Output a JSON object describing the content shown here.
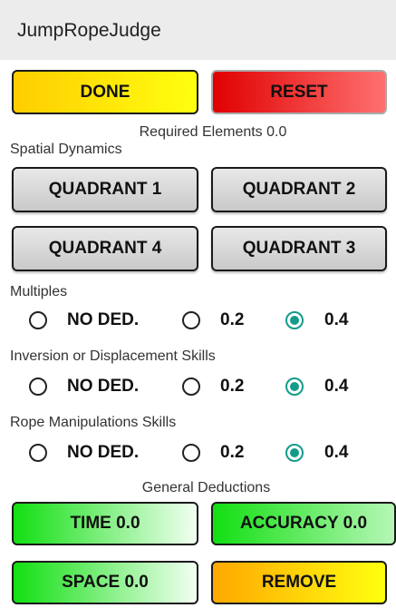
{
  "app": {
    "title": "JumpRopeJudge"
  },
  "top_buttons": {
    "done": "DONE",
    "reset": "RESET"
  },
  "required_elements": "Required Elements 0.0",
  "spatial": {
    "label": "Spatial Dynamics",
    "q1": "QUADRANT 1",
    "q2": "QUADRANT 2",
    "q4": "QUADRANT 4",
    "q3": "QUADRANT 3"
  },
  "groups": [
    {
      "label": "Multiples",
      "options": [
        "NO DED.",
        "0.2",
        "0.4"
      ],
      "selected": "0.4"
    },
    {
      "label": "Inversion or Displacement Skills",
      "options": [
        "NO DED.",
        "0.2",
        "0.4"
      ],
      "selected": "0.4"
    },
    {
      "label": "Rope Manipulations Skills",
      "options": [
        "NO DED.",
        "0.2",
        "0.4"
      ],
      "selected": "0.4"
    }
  ],
  "general": {
    "label": "General Deductions",
    "time": "TIME 0.0",
    "accuracy": "ACCURACY 0.0",
    "space": "SPACE 0.0",
    "remove": "REMOVE"
  },
  "colors": {
    "done": "#ffd400",
    "reset": "#e01010",
    "green": "#12e012",
    "remove": "#ffb300",
    "radio_checked": "#139b8a"
  }
}
